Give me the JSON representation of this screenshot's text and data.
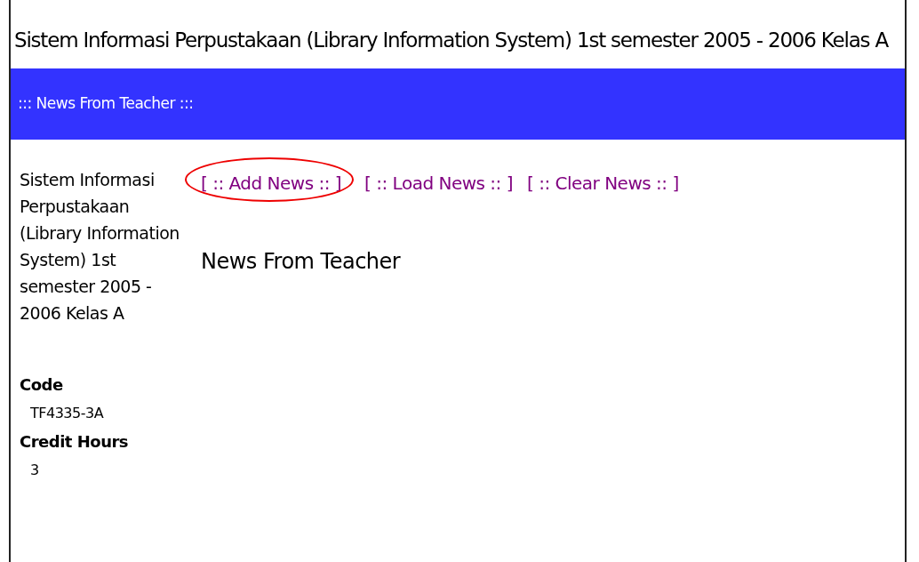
{
  "page_title": "Sistem Informasi Perpustakaan (Library Information System) 1st semester 2005 - 2006 Kelas A",
  "header_bar": "::: News From Teacher :::",
  "course_title": "Sistem Informasi Perpustakaan (Library Information System) 1st semester 2005 - 2006 Kelas A",
  "links": [
    {
      "label": "[ :: Add News :: ]",
      "circled": true
    },
    {
      "label": "[ :: Load News :: ]",
      "circled": false
    },
    {
      "label": "[ :: Clear News :: ]",
      "circled": false
    }
  ],
  "content_heading": "News From Teacher",
  "fields": [
    {
      "label": "Code",
      "value": "TF4335-3A"
    },
    {
      "label": "Credit Hours",
      "value": "3"
    }
  ]
}
